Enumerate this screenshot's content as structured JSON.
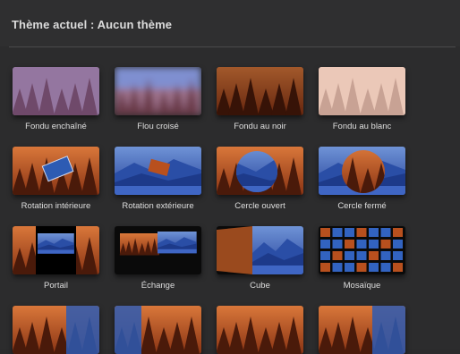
{
  "header": {
    "title": "Thème actuel : Aucun thème"
  },
  "transitions": [
    {
      "label": "Fondu enchaîné",
      "style": "crossfade"
    },
    {
      "label": "Flou croisé",
      "style": "blur"
    },
    {
      "label": "Fondu au noir",
      "style": "black"
    },
    {
      "label": "Fondu au blanc",
      "style": "white"
    },
    {
      "label": "Rotation intérieure",
      "style": "rotin"
    },
    {
      "label": "Rotation extérieure",
      "style": "rotout"
    },
    {
      "label": "Cercle ouvert",
      "style": "circleopen"
    },
    {
      "label": "Cercle fermé",
      "style": "circleclose"
    },
    {
      "label": "Portail",
      "style": "portal"
    },
    {
      "label": "Échange",
      "style": "swap"
    },
    {
      "label": "Cube",
      "style": "cube"
    },
    {
      "label": "Mosaïque",
      "style": "mosaic"
    },
    {
      "label": "",
      "style": "forestblue"
    },
    {
      "label": "",
      "style": "forestblue2"
    },
    {
      "label": "",
      "style": "forest"
    },
    {
      "label": "",
      "style": "forestblue3"
    }
  ],
  "colors": {
    "forest": "#b8501e",
    "mountain": "#2d5bb3",
    "sky": "#6f93d6"
  }
}
